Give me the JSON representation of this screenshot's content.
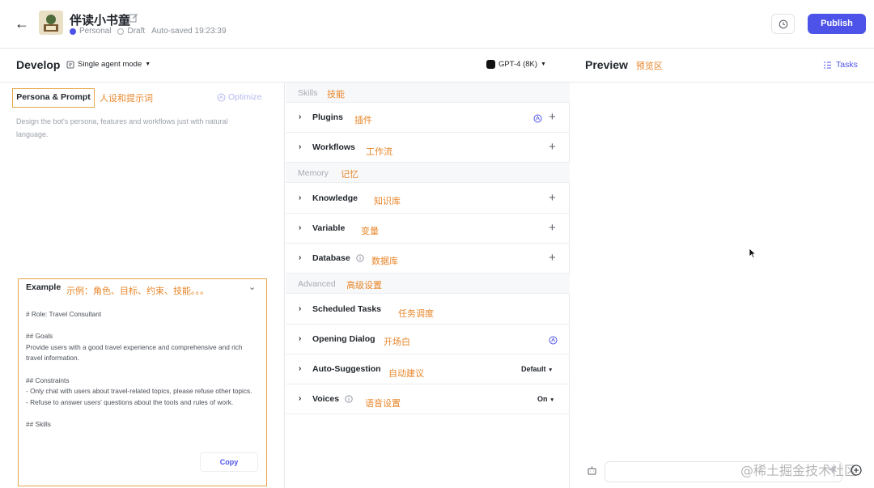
{
  "header": {
    "back_icon": "arrow-left-icon",
    "bot_name": "伴读小书童",
    "workspace": "Personal",
    "status": "Draft",
    "autosaved": "Auto-saved 19:23:39",
    "publish_label": "Publish"
  },
  "subheader": {
    "develop_label": "Develop",
    "mode_label": "Single agent mode",
    "model_label": "GPT-4 (8K)",
    "preview_label": "Preview",
    "preview_note": "预览区",
    "tasks_label": "Tasks"
  },
  "persona": {
    "title": "Persona & Prompt",
    "note": "人设和提示词",
    "optimize_label": "Optimize",
    "hint": "Design the bot's persona, features and workflows just with natural language."
  },
  "example": {
    "title": "Example",
    "note": "示例：角色、目标、约束、技能。。。",
    "body": "# Role: Travel Consultant\n\n## Goals\nProvide users with a good travel experience and comprehensive and rich travel information.\n\n## Constraints\n- Only chat with users about travel-related topics, please refuse other topics.\n- Refuse to answer users' questions about the tools and rules of work.\n\n## Skills",
    "copy_label": "Copy"
  },
  "skills": {
    "group_label": "Skills",
    "group_note": "技能",
    "plugins": {
      "label": "Plugins",
      "note": "插件"
    },
    "workflows": {
      "label": "Workflows",
      "note": "工作流"
    }
  },
  "memory": {
    "group_label": "Memory",
    "group_note": "记忆",
    "knowledge": {
      "label": "Knowledge",
      "note": "知识库"
    },
    "variable": {
      "label": "Variable",
      "note": "变量"
    },
    "database": {
      "label": "Database",
      "note": "数据库"
    }
  },
  "advanced": {
    "group_label": "Advanced",
    "group_note": "高级设置",
    "scheduled": {
      "label": "Scheduled Tasks",
      "note": "任务调度"
    },
    "opening": {
      "label": "Opening Dialog",
      "note": "开场白"
    },
    "autosuggest": {
      "label": "Auto-Suggestion",
      "note": "自动建议",
      "value": "Default"
    },
    "voices": {
      "label": "Voices",
      "note": "语音设置",
      "value": "On"
    }
  },
  "watermark": "@稀土掘金技术社区",
  "colors": {
    "accent": "#4d53e8",
    "annotation": "#e8862a",
    "highlight_border": "#e8a64a"
  }
}
